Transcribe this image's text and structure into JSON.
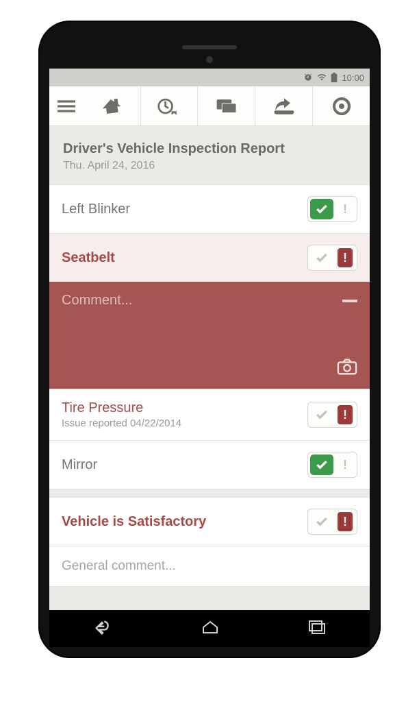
{
  "statusbar": {
    "time": "10:00"
  },
  "header": {
    "title": "Driver's Vehicle Inspection Report",
    "date": "Thu. April 24, 2016"
  },
  "items": [
    {
      "label": "Left Blinker",
      "state": "ok"
    },
    {
      "label": "Seatbelt",
      "state": "fail"
    },
    {
      "label": "Tire Pressure",
      "sub": "Issue reported 04/22/2014",
      "state": "fail"
    },
    {
      "label": "Mirror",
      "state": "ok"
    }
  ],
  "comment_panel": {
    "placeholder": "Comment..."
  },
  "satisfactory": {
    "label": "Vehicle is Satisfactory",
    "state": "fail"
  },
  "general_comment": {
    "placeholder": "General comment..."
  }
}
